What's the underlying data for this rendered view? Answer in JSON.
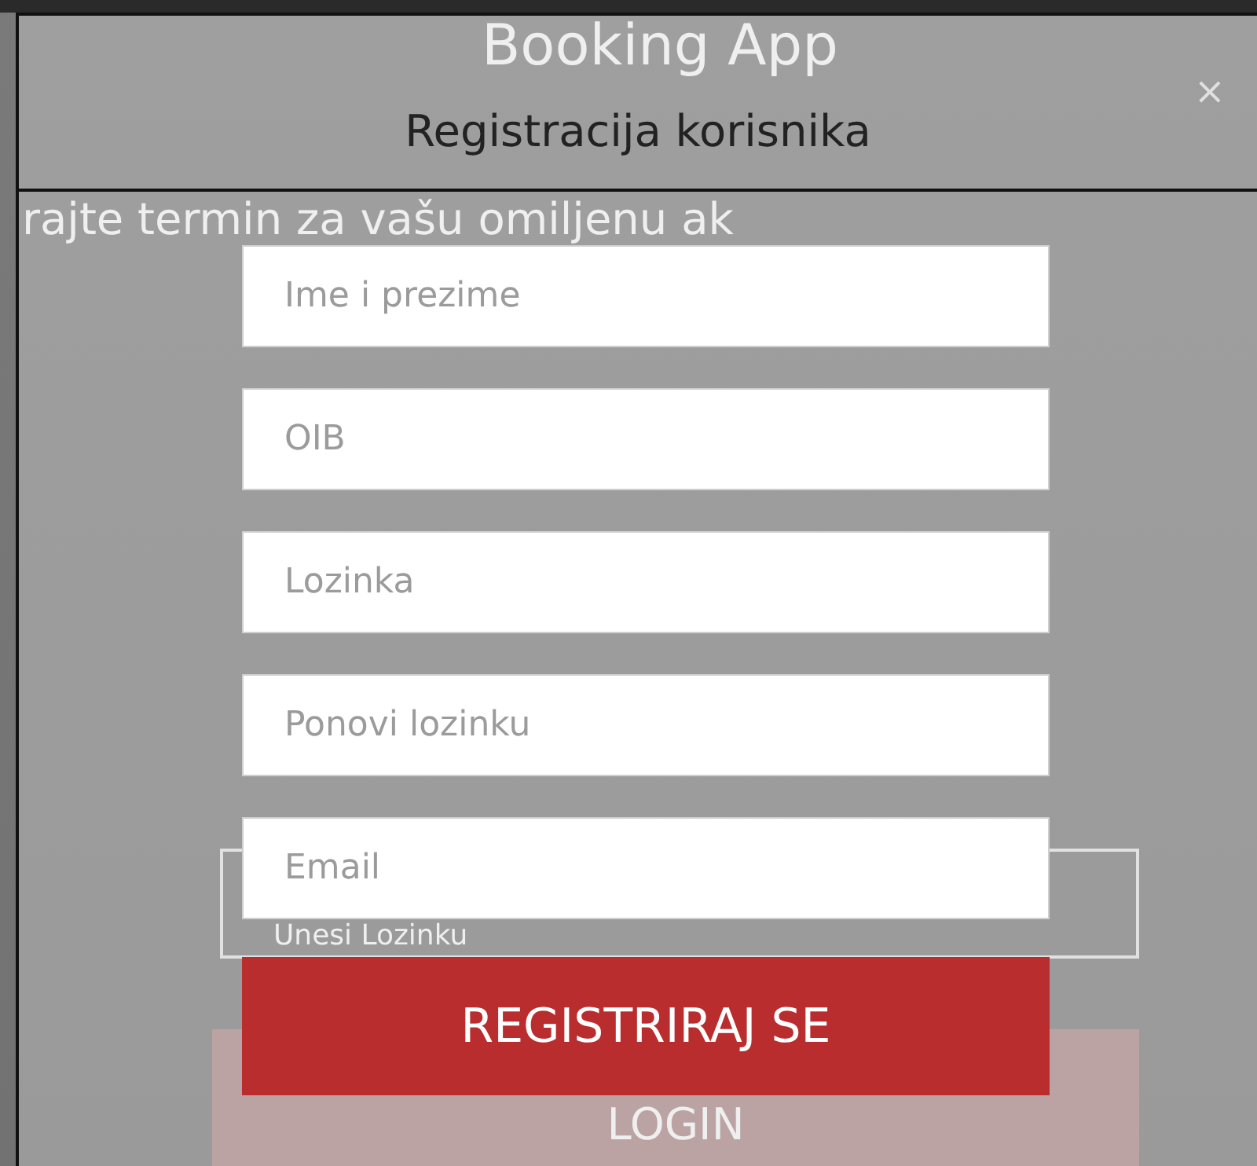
{
  "background_page": {
    "title": "Booking App",
    "subtitle": "rajte termin za vašu omiljenu ak",
    "password_placeholder": "Unesi Lozinku",
    "login_button": "LOGIN"
  },
  "modal": {
    "title": "Registracija korisnika",
    "close": "×",
    "fields": [
      {
        "placeholder": "Ime i prezime"
      },
      {
        "placeholder": "OIB"
      },
      {
        "placeholder": "Lozinka"
      },
      {
        "placeholder": "Ponovi lozinku"
      },
      {
        "placeholder": "Email"
      }
    ],
    "submit": "REGISTRIRAJ SE"
  }
}
